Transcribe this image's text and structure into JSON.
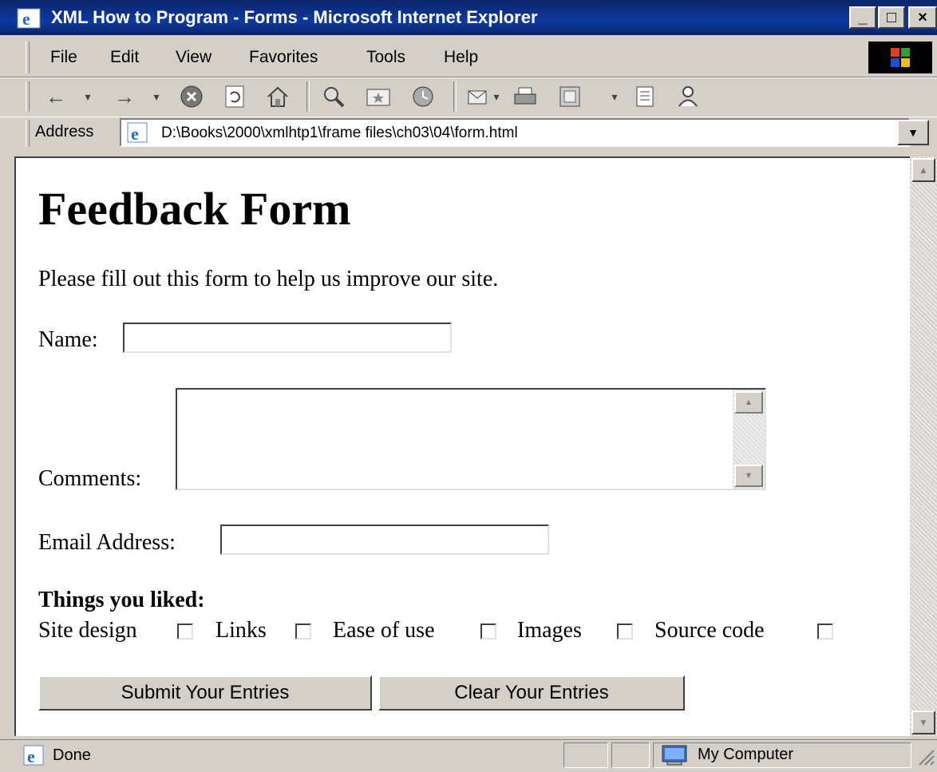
{
  "window": {
    "title": "XML How to Program - Forms - Microsoft Internet Explorer",
    "minimize": "_",
    "maximize": "□",
    "close": "×"
  },
  "menu": [
    "File",
    "Edit",
    "View",
    "Favorites",
    "Tools",
    "Help"
  ],
  "toolbar": {
    "icons": [
      "back-icon",
      "forward-icon",
      "stop-icon",
      "refresh-icon",
      "home-icon",
      "search-icon",
      "favorites-icon",
      "history-icon",
      "mail-icon",
      "print-icon",
      "edit-icon",
      "discuss-icon",
      "messenger-icon"
    ]
  },
  "address": {
    "label": "Address",
    "value": "D:\\Books\\2000\\xmlhtp1\\frame files\\ch03\\04\\form.html"
  },
  "page": {
    "heading": "Feedback Form",
    "intro": "Please fill out this form to help us improve our site.",
    "name_label": "Name:",
    "name_value": "",
    "comments_label": "Comments:",
    "comments_value": "",
    "email_label": "Email Address:",
    "email_value": "",
    "liked_label": "Things you liked",
    "liked_colon": ":",
    "options": [
      {
        "label": "Site design",
        "checked": false
      },
      {
        "label": "Links",
        "checked": false
      },
      {
        "label": "Ease of use",
        "checked": false
      },
      {
        "label": "Images",
        "checked": false
      },
      {
        "label": "Source code",
        "checked": false
      }
    ],
    "submit_label": "Submit Your Entries",
    "reset_label": "Clear Your Entries"
  },
  "status": {
    "text": "Done",
    "zone": "My Computer"
  }
}
